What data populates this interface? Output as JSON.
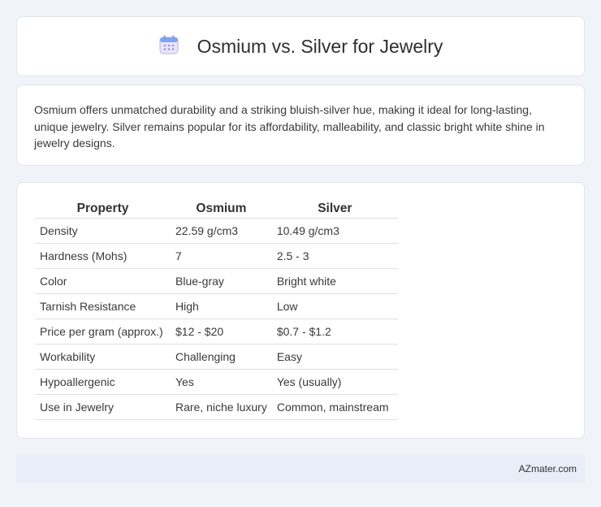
{
  "header": {
    "icon": "calendar-icon",
    "title": "Osmium vs. Silver for Jewelry"
  },
  "intro": {
    "text": "Osmium offers unmatched durability and a striking bluish-silver hue, making it ideal for long-lasting, unique jewelry. Silver remains popular for its affordability, malleability, and classic bright white shine in jewelry designs."
  },
  "table": {
    "headers": [
      "Property",
      "Osmium",
      "Silver"
    ],
    "rows": [
      [
        "Density",
        "22.59 g/cm3",
        "10.49 g/cm3"
      ],
      [
        "Hardness (Mohs)",
        "7",
        "2.5 - 3"
      ],
      [
        "Color",
        "Blue-gray",
        "Bright white"
      ],
      [
        "Tarnish Resistance",
        "High",
        "Low"
      ],
      [
        "Price per gram (approx.)",
        "$12 - $20",
        "$0.7 - $1.2"
      ],
      [
        "Workability",
        "Challenging",
        "Easy"
      ],
      [
        "Hypoallergenic",
        "Yes",
        "Yes (usually)"
      ],
      [
        "Use in Jewelry",
        "Rare, niche luxury",
        "Common, mainstream"
      ]
    ]
  },
  "footer": {
    "brand": "AZmater.com"
  },
  "colors": {
    "page_background": "#f0f3f8",
    "card_background": "#ffffff",
    "footer_background": "#e8edf7",
    "icon_accent": "#8f7ee0"
  }
}
